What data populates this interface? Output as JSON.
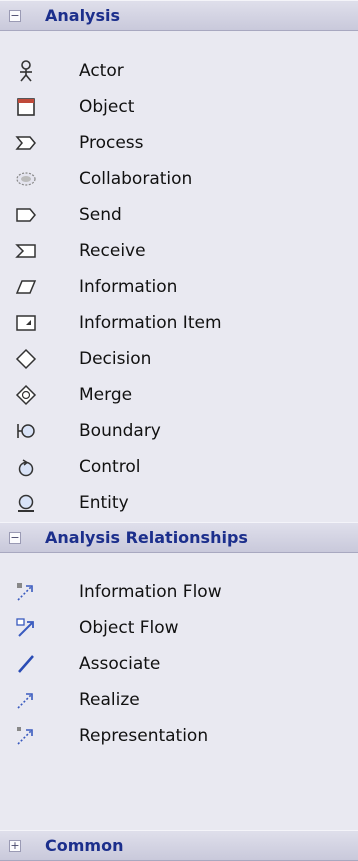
{
  "groups": [
    {
      "title": "Analysis",
      "expander": "−",
      "items": [
        {
          "label": "Actor",
          "icon": "actor-icon"
        },
        {
          "label": "Object",
          "icon": "object-icon"
        },
        {
          "label": "Process",
          "icon": "process-icon"
        },
        {
          "label": "Collaboration",
          "icon": "collaboration-icon"
        },
        {
          "label": "Send",
          "icon": "send-icon"
        },
        {
          "label": "Receive",
          "icon": "receive-icon"
        },
        {
          "label": "Information",
          "icon": "information-icon"
        },
        {
          "label": "Information Item",
          "icon": "information-item-icon"
        },
        {
          "label": "Decision",
          "icon": "decision-icon"
        },
        {
          "label": "Merge",
          "icon": "merge-icon"
        },
        {
          "label": "Boundary",
          "icon": "boundary-icon"
        },
        {
          "label": "Control",
          "icon": "control-icon"
        },
        {
          "label": "Entity",
          "icon": "entity-icon"
        }
      ]
    },
    {
      "title": "Analysis Relationships",
      "expander": "−",
      "items": [
        {
          "label": "Information Flow",
          "icon": "information-flow-icon"
        },
        {
          "label": "Object Flow",
          "icon": "object-flow-icon"
        },
        {
          "label": "Associate",
          "icon": "associate-icon"
        },
        {
          "label": "Realize",
          "icon": "realize-icon"
        },
        {
          "label": "Representation",
          "icon": "representation-icon"
        }
      ]
    },
    {
      "title": "Common",
      "expander": "+",
      "items": []
    }
  ],
  "colors": {
    "header_text": "#1c2f8c",
    "panel_bg": "#e9e9f1",
    "icon_blue": "#3a5bbf"
  }
}
